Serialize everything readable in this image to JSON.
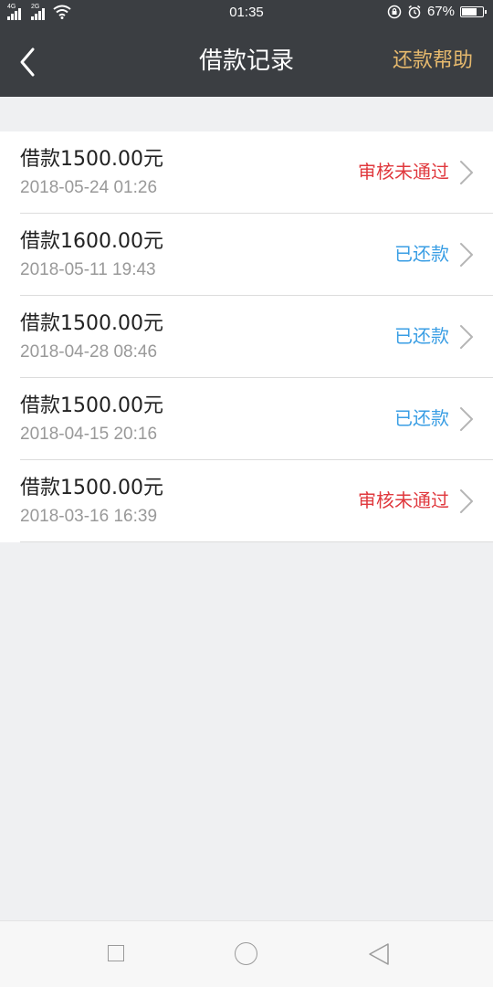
{
  "status_bar": {
    "net1": "4G",
    "net2": "2G",
    "time": "01:35",
    "battery": "67%",
    "battery_level": 0.67
  },
  "header": {
    "title": "借款记录",
    "help": "还款帮助"
  },
  "records": [
    {
      "amount": "借款1500.00元",
      "date": "2018-05-24 01:26",
      "status": "审核未通过",
      "type": "rejected"
    },
    {
      "amount": "借款1600.00元",
      "date": "2018-05-11 19:43",
      "status": "已还款",
      "type": "repaid"
    },
    {
      "amount": "借款1500.00元",
      "date": "2018-04-28 08:46",
      "status": "已还款",
      "type": "repaid"
    },
    {
      "amount": "借款1500.00元",
      "date": "2018-04-15 20:16",
      "status": "已还款",
      "type": "repaid"
    },
    {
      "amount": "借款1500.00元",
      "date": "2018-03-16 16:39",
      "status": "审核未通过",
      "type": "rejected"
    }
  ],
  "colors": {
    "header_bg": "#3b3e42",
    "help_text": "#e6b96d",
    "rejected": "#e0393e",
    "repaid": "#3a9ee4",
    "page_bg": "#eff0f2"
  }
}
